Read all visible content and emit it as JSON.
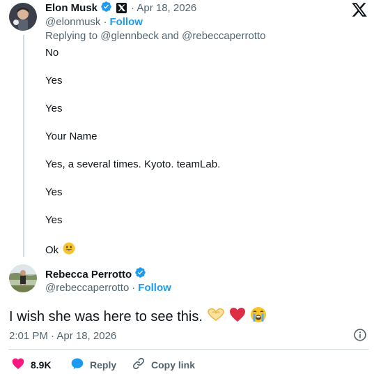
{
  "parent_tweet": {
    "author_name": "Elon Musk",
    "date": "· Apr 18, 2026",
    "handle": "@elonmusk",
    "separator": "·",
    "follow_label": "Follow",
    "replying_to": "Replying to @glennbeck and @rebeccaperrotto",
    "answers": [
      "No",
      "Yes",
      "Yes",
      "Your Name",
      "Yes, a several times. Kyoto. teamLab.",
      "Yes",
      "Yes",
      "Ok"
    ],
    "badge_icon": "x-logo-badge-icon",
    "verified_icon": "verified-icon"
  },
  "x_logo": "x-logo-icon",
  "main_tweet": {
    "author_name": "Rebecca Perrotto",
    "handle": "@rebeccaperrotto",
    "separator": "·",
    "follow_label": "Follow",
    "text": "I wish she was here to see this.",
    "timestamp": "2:01 PM · Apr 18, 2026",
    "info_icon": "info-icon"
  },
  "actions": {
    "like_count": "8.9K",
    "reply_label": "Reply",
    "copy_label": "Copy link"
  },
  "colors": {
    "accent": "#1d9bf0",
    "like": "#f91880",
    "muted": "#536471",
    "text": "#0f1419"
  }
}
